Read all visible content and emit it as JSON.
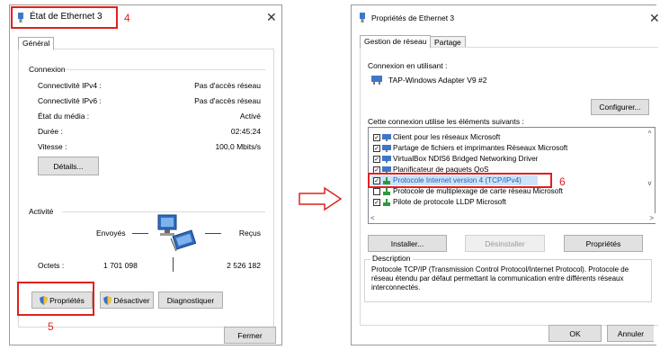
{
  "left_dialog": {
    "title": "État de Ethernet 3",
    "callout": "4",
    "tab": "Général",
    "connection": {
      "section": "Connexion",
      "rows": [
        {
          "label": "Connectivité IPv4 :",
          "value": "Pas d'accès réseau"
        },
        {
          "label": "Connectivité IPv6 :",
          "value": "Pas d'accès réseau"
        },
        {
          "label": "État du média :",
          "value": "Activé"
        },
        {
          "label": "Durée :",
          "value": "02:45:24"
        },
        {
          "label": "Vitesse :",
          "value": "100,0 Mbits/s"
        }
      ],
      "details_button": "Détails..."
    },
    "activity": {
      "section": "Activité",
      "sent_label": "Envoyés",
      "received_label": "Reçus",
      "bytes_label": "Octets :",
      "bytes_sent": "1 701 098",
      "bytes_received": "2 526 182"
    },
    "buttons": {
      "properties": "Propriétés",
      "disable": "Désactiver",
      "diagnose": "Diagnostiquer",
      "close": "Fermer"
    },
    "callout2": "5"
  },
  "right_dialog": {
    "title": "Propriétés de Ethernet 3",
    "tabs": [
      "Gestion de réseau",
      "Partage"
    ],
    "connect_using_label": "Connexion en utilisant :",
    "adapter": "TAP-Windows Adapter V9 #2",
    "configure_button": "Configurer...",
    "items_label": "Cette connexion utilise les éléments suivants :",
    "items": [
      {
        "label": "Client pour les réseaux Microsoft",
        "checked": true
      },
      {
        "label": "Partage de fichiers et imprimantes Réseaux Microsoft",
        "checked": true
      },
      {
        "label": "VirtualBox NDIS6 Bridged Networking Driver",
        "checked": true
      },
      {
        "label": "Planificateur de paquets QoS",
        "checked": true
      },
      {
        "label": "Protocole Internet version 4 (TCP/IPv4)",
        "checked": true
      },
      {
        "label": "Protocole de multiplexage de carte réseau Microsoft",
        "checked": false
      },
      {
        "label": "Pilote de protocole LLDP Microsoft",
        "checked": true
      }
    ],
    "callout": "6",
    "install_button": "Installer...",
    "uninstall_button": "Désinstaller",
    "properties_button": "Propriétés",
    "description_title": "Description",
    "description_text": "Protocole TCP/IP (Transmission Control Protocol/Internet Protocol). Protocole de réseau étendu par défaut permettant la communication entre différents réseaux interconnectés.",
    "ok_button": "OK",
    "cancel_button": "Annuler"
  },
  "colors": {
    "callout_red": "#e02020",
    "selection_blue": "#0078d7",
    "accent": "#1f5fbf"
  },
  "icons": [
    "network-adapter-icon",
    "close-icon",
    "shield-icon",
    "network-computers-icon",
    "protocol-icon",
    "arrow-right-icon"
  ]
}
